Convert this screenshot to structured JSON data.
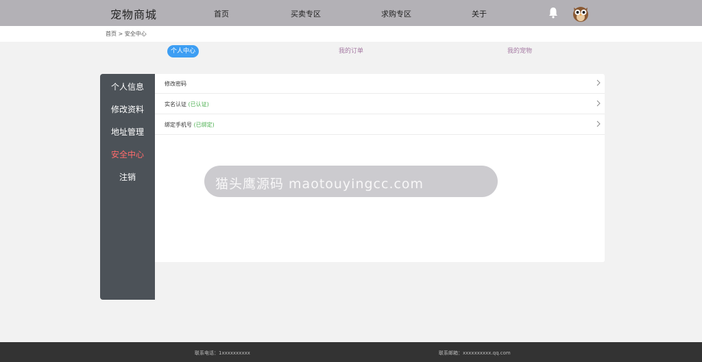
{
  "header": {
    "logo": "宠物商城",
    "nav": [
      {
        "label": "首页"
      },
      {
        "label": "买卖专区"
      },
      {
        "label": "求购专区"
      },
      {
        "label": "关于"
      }
    ]
  },
  "breadcrumb": {
    "home": "首页",
    "separator": ">",
    "current": "安全中心"
  },
  "tabs": [
    {
      "label": "个人中心",
      "active": true
    },
    {
      "label": "我的订单",
      "active": false
    },
    {
      "label": "我的宠物",
      "active": false
    }
  ],
  "sidebar": {
    "items": [
      {
        "label": "个人信息",
        "active": false
      },
      {
        "label": "修改资料",
        "active": false
      },
      {
        "label": "地址管理",
        "active": false
      },
      {
        "label": "安全中心",
        "active": true
      },
      {
        "label": "注销",
        "active": false
      }
    ]
  },
  "security": {
    "rows": [
      {
        "label": "修改密码",
        "status": ""
      },
      {
        "label": "实名认证",
        "status": "(已认证)"
      },
      {
        "label": "绑定手机号",
        "status": "(已绑定)"
      }
    ]
  },
  "watermark": {
    "text": "猫头鹰源码 maotouyingcc.com"
  },
  "footer": {
    "phone": "联系电话：1xxxxxxxxxx",
    "email": "联系邮箱：xxxxxxxxxx.qq.com"
  },
  "colors": {
    "topbar": "#b3b1b6",
    "sidebar": "#4c5258",
    "active_tab": "#3d9ef3",
    "sidebar_active": "#ff6b6b",
    "status_green": "#4caf50",
    "footer": "#333333"
  }
}
